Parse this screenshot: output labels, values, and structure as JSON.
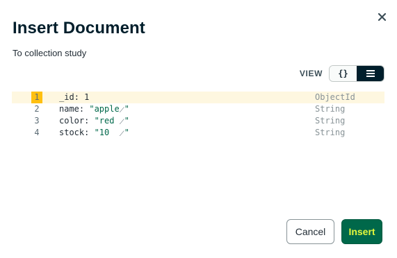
{
  "dialog": {
    "title": "Insert Document",
    "subtitle": "To collection study",
    "close_icon": "close-icon"
  },
  "view": {
    "label": "VIEW",
    "options": [
      {
        "name": "json-view",
        "label": "{}",
        "active": false
      },
      {
        "name": "list-view",
        "icon": "list-icon",
        "active": true
      }
    ]
  },
  "document": {
    "rows": [
      {
        "line": "1",
        "key": "_id",
        "value": "1",
        "value_kind": "number",
        "type": "ObjectId",
        "highlighted": true
      },
      {
        "line": "2",
        "key": "name",
        "value": "\"apple",
        "value_end": "\"",
        "value_kind": "string",
        "type": "String",
        "highlighted": false
      },
      {
        "line": "3",
        "key": "color",
        "value": "\"red ",
        "value_end": "\"",
        "value_kind": "string",
        "type": "String",
        "highlighted": false
      },
      {
        "line": "4",
        "key": "stock",
        "value": "\"10  ",
        "value_end": "\"",
        "value_kind": "string",
        "type": "String",
        "highlighted": false
      }
    ]
  },
  "footer": {
    "cancel_label": "Cancel",
    "insert_label": "Insert"
  },
  "colors": {
    "primary_green": "#00684a",
    "highlight_yellow": "#e4f83c",
    "dark": "#001e2b",
    "line_highlight": "#fef7e0",
    "gutter_marker": "#ffc010"
  }
}
